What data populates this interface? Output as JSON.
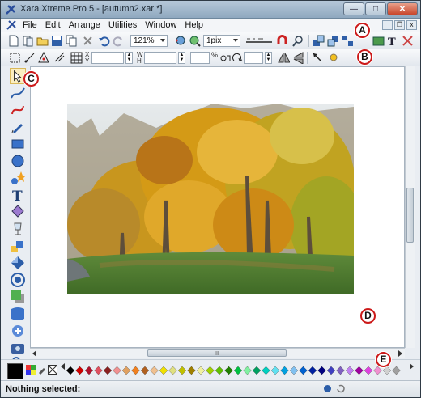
{
  "window": {
    "title": "Xara Xtreme Pro 5 - [autumn2.xar *]"
  },
  "menubar": {
    "items": [
      "File",
      "Edit",
      "Arrange",
      "Utilities",
      "Window",
      "Help"
    ]
  },
  "toolbar": {
    "zoom_value": "121%",
    "line_width_value": "1pix",
    "x_label": "X",
    "y_label": "Y",
    "w_label": "W",
    "h_label": "H"
  },
  "markers": {
    "a": "A",
    "b": "B",
    "c": "C",
    "d": "D",
    "e": "E"
  },
  "status": {
    "text": "Nothing selected:"
  },
  "colors": {
    "current_fill": "#000000",
    "palette": [
      "#000000",
      "#d00000",
      "#b0102a",
      "#e05060",
      "#8a2020",
      "#f09090",
      "#e0a060",
      "#f08020",
      "#b06020",
      "#f0c090",
      "#f0e000",
      "#e0e080",
      "#c0c000",
      "#a08000",
      "#f0f0a0",
      "#a0d000",
      "#60c000",
      "#208000",
      "#00c040",
      "#80f0a0",
      "#00a060",
      "#00d0c0",
      "#60e0f0",
      "#00a0e0",
      "#80c0f0",
      "#0060d0",
      "#0020a0",
      "#000080",
      "#4040c0",
      "#8060c0",
      "#c080f0",
      "#a000a0",
      "#e040e0",
      "#f090d0",
      "#d0d0d0",
      "#a0a0a0"
    ]
  },
  "icons": {
    "toolbar1": [
      "new-icon",
      "open-icon",
      "open-folder-icon",
      "save-icon",
      "copy-icon",
      "cut-icon",
      "undo-icon",
      "redo-icon"
    ],
    "tools": [
      "selector-tool-icon",
      "freehand-tool-icon",
      "bezier-tool-icon",
      "pen-tool-icon",
      "rectangle-tool-icon",
      "ellipse-tool-icon",
      "shape-tool-icon",
      "text-tool-icon",
      "fill-tool-icon",
      "transparency-tool-icon",
      "blend-tool-icon",
      "bevel-tool-icon",
      "contour-tool-icon",
      "shadow-tool-icon",
      "mould-tool-icon",
      "live-effects-tool-icon",
      "photo-tool-icon",
      "zoom-tool-icon"
    ]
  }
}
